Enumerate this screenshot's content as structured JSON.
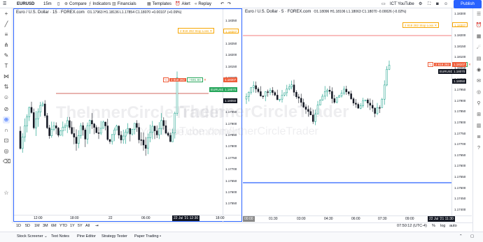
{
  "toolbar": {
    "symbol": "EURUSD",
    "interval": "15m",
    "compare": "Compare",
    "indicators": "Indicators",
    "financials": "Financials",
    "templates": "Templates",
    "alert": "Alert",
    "replay": "Replay",
    "layout_name": "ICT YouTube",
    "publish": "Publish"
  },
  "left_pane": {
    "title": "Euro / U.S. Dollar · 15 · FOREX.com",
    "ohlc": "O1.17963 H1.18136 L1.17854 C1.18070 +0.00107 (+0.09%)",
    "price_axis": [
      "1.18350",
      "1.18300",
      "1.18250",
      "1.18200",
      "1.18150",
      "1.18100",
      "1.18050",
      "1.18000",
      "1.17950",
      "1.17900",
      "1.17850",
      "1.17800",
      "1.17750",
      "1.17700",
      "1.17650",
      "1.17600",
      "1.17550"
    ],
    "stop_loss_label": "2 818 282  Stop Loss",
    "stop_price": "1.18307",
    "order_qty": "2 818 282",
    "order_pnl": "+591.84",
    "symbol_tag": "EURUSD",
    "last_price": "1.18070",
    "cross_price": "1.18050",
    "time_labels": [
      "12:00",
      "18:00",
      "22",
      "06:00",
      "18:00"
    ],
    "time_box": "22 Jul '21  12:30"
  },
  "right_pane": {
    "title": "Euro / U.S. Dollar · 5 · FOREX.com",
    "ohlc": "O1.18096 H1.18106 L1.18063 C1.18070 -0.00026 (-0.02%)",
    "price_axis": [
      "1.18300",
      "1.18250",
      "1.18200",
      "1.18150",
      "1.18100",
      "1.18050",
      "1.18000",
      "1.17950",
      "1.17900",
      "1.17850",
      "1.17800",
      "1.17750",
      "1.17700",
      "1.17650",
      "1.17600",
      "1.17550",
      "1.17500",
      "1.17450",
      "1.17400"
    ],
    "stop_loss_label": "2 818 282  Stop Loss",
    "stop_price": "1.18307",
    "order_qty": "2 818 282",
    "order_pnl": "+591.84",
    "symbol_tag": "EURUSD",
    "last_price": "1.18070",
    "order_price": "1.18107",
    "cross_price": "1.18050",
    "time_labels": [
      "00:00",
      "01:30",
      "03:00",
      "04:30",
      "06:00",
      "07:30",
      "09:00"
    ],
    "time_box": "22 Jul '21  11:30"
  },
  "watermark": {
    "line1": "TheInnerCircleTrader",
    "line2": "YouTube.com/InnerCircleTrader"
  },
  "ranges": [
    "1D",
    "5D",
    "1M",
    "3M",
    "6M",
    "YTD",
    "1Y",
    "5Y",
    "All"
  ],
  "clock": "07:50:12 (UTC-4)",
  "bottom_right": [
    "%",
    "log",
    "auto"
  ],
  "panels": [
    "Stock Screener",
    "Text Notes",
    "Pine Editor",
    "Strategy Tester",
    "Paper Trading"
  ],
  "colors": {
    "accent": "#2962ff",
    "bull": "#089981",
    "bear": "#131722",
    "stop": "#f7a600",
    "red_line": "#ef5350",
    "order": "#ef5d3a",
    "green_tag": "#26a65b"
  }
}
